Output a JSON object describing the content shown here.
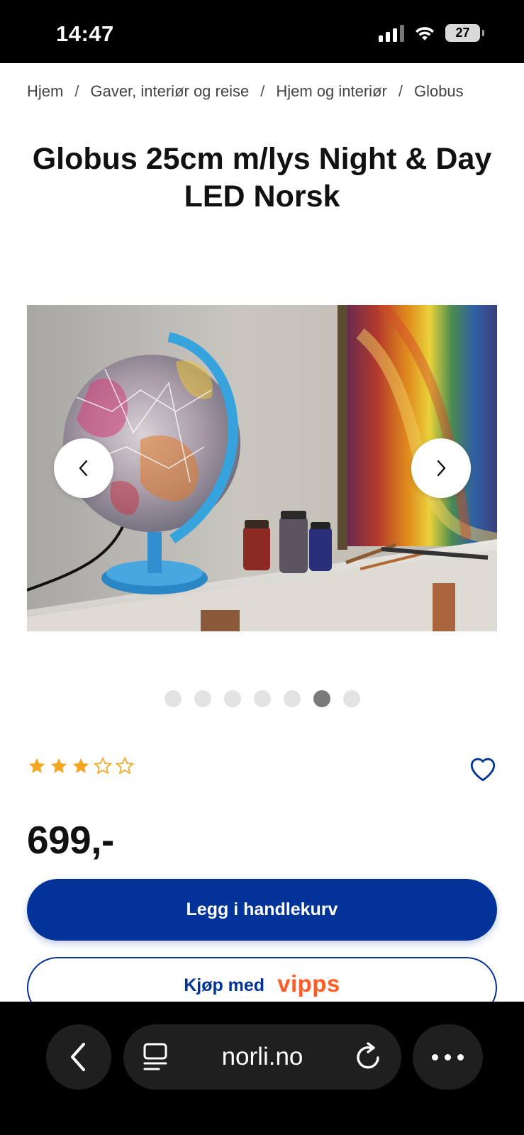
{
  "status_bar": {
    "time": "14:47",
    "battery": "27"
  },
  "breadcrumb": [
    "Hjem",
    "Gaver, interiør og reise",
    "Hjem og interiør",
    "Globus"
  ],
  "product": {
    "title": "Globus 25cm m/lys Night & Day LED Norsk",
    "rating": 3,
    "rating_max": 5,
    "price": "699,-",
    "image_count": 7,
    "active_image": 6
  },
  "buttons": {
    "add_to_cart": "Legg i handlekurv",
    "vipps_label": "Kjøp med",
    "vipps_logo": "vipps"
  },
  "browser": {
    "url": "norli.no"
  },
  "colors": {
    "primary": "#023399",
    "star": "#f5a623",
    "vipps": "#ff5b24"
  }
}
